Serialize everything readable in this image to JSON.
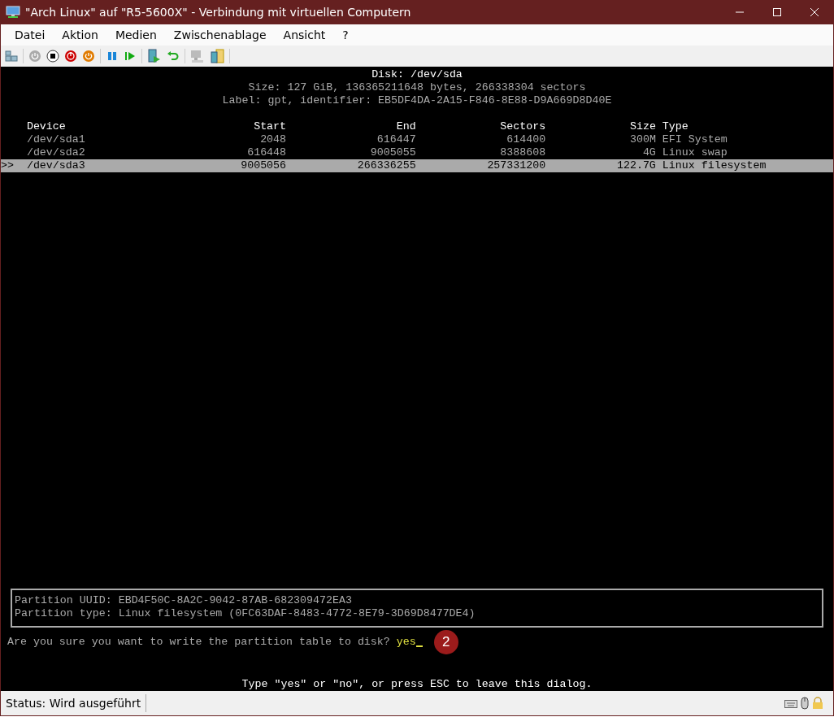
{
  "window": {
    "title": "\"Arch Linux\" auf \"R5-5600X\" - Verbindung mit virtuellen Computern"
  },
  "menu": [
    "Datei",
    "Aktion",
    "Medien",
    "Zwischenablage",
    "Ansicht",
    "?"
  ],
  "terminal": {
    "header": [
      "Disk: /dev/sda",
      "Size: 127 GiB, 136365211648 bytes, 266338304 sectors",
      "Label: gpt, identifier: EB5DF4DA-2A15-F846-8E88-D9A669D8D40E"
    ],
    "columns": [
      "Device",
      "Start",
      "End",
      "Sectors",
      "Size",
      "Type"
    ],
    "rows": [
      {
        "marker": "",
        "selected": false,
        "cells": [
          "/dev/sda1",
          "2048",
          "616447",
          "614400",
          "300M",
          "EFI System"
        ]
      },
      {
        "marker": "",
        "selected": false,
        "cells": [
          "/dev/sda2",
          "616448",
          "9005055",
          "8388608",
          "4G",
          "Linux swap"
        ]
      },
      {
        "marker": ">>",
        "selected": true,
        "cells": [
          "/dev/sda3",
          "9005056",
          "266336255",
          "257331200",
          "122.7G",
          "Linux filesystem"
        ]
      }
    ],
    "info": [
      "Partition UUID: EBD4F50C-8A2C-9042-87AB-682309472EA3",
      "Partition type: Linux filesystem (0FC63DAF-8483-4772-8E79-3D69D8477DE4)"
    ],
    "prompt": {
      "question": "Are you sure you want to write the partition table to disk?",
      "value": "yes"
    },
    "annotation_badge": "2",
    "hint": "Type \"yes\" or \"no\", or press ESC to leave this dialog."
  },
  "status_bar": {
    "text": "Status: Wird ausgeführt"
  }
}
